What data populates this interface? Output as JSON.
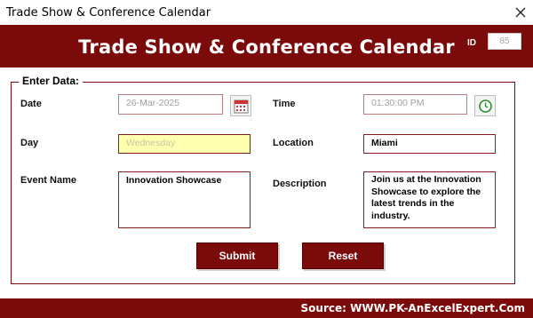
{
  "window": {
    "title": "Trade Show & Conference Calendar"
  },
  "header": {
    "title": "Trade Show & Conference Calendar",
    "id_label": "ID",
    "id_value": "85"
  },
  "form": {
    "legend": "Enter Data:",
    "date": {
      "label": "Date",
      "value": "26-Mar-2025"
    },
    "time": {
      "label": "Time",
      "value": "01:30:00 PM"
    },
    "day": {
      "label": "Day",
      "value": "Wednesday"
    },
    "location": {
      "label": "Location",
      "value": "Miami"
    },
    "event_name": {
      "label": "Event Name",
      "value": "Innovation Showcase"
    },
    "description": {
      "label": "Description",
      "value": "Join us at the Innovation Showcase to explore the latest trends in the industry."
    }
  },
  "buttons": {
    "submit": "Submit",
    "reset": "Reset"
  },
  "footer": {
    "source": "Source: WWW.PK-AnExcelExpert.Com"
  },
  "colors": {
    "accent": "#7b0a0a",
    "day_highlight": "#ffffb0",
    "clock_green": "#2e8b2e"
  },
  "icons": {
    "date_picker": "calendar-icon",
    "time_picker": "clock-icon",
    "close": "close-icon"
  }
}
